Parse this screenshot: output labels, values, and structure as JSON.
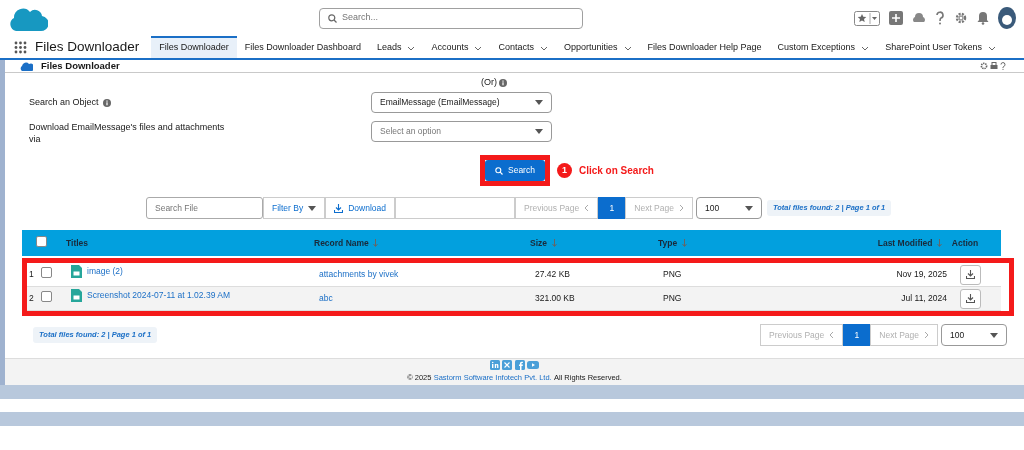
{
  "app_header": {
    "search_placeholder": "Search..."
  },
  "nav": {
    "app_name": "Files Downloader",
    "tabs": [
      {
        "label": "Files Downloader",
        "selected": true,
        "has_menu": false
      },
      {
        "label": "Files Downloader Dashboard",
        "selected": false,
        "has_menu": false
      },
      {
        "label": "Leads",
        "selected": false,
        "has_menu": true
      },
      {
        "label": "Accounts",
        "selected": false,
        "has_menu": true
      },
      {
        "label": "Contacts",
        "selected": false,
        "has_menu": true
      },
      {
        "label": "Opportunities",
        "selected": false,
        "has_menu": true
      },
      {
        "label": "Files Downloader Help Page",
        "selected": false,
        "has_menu": false
      },
      {
        "label": "Custom Exceptions",
        "selected": false,
        "has_menu": true
      },
      {
        "label": "SharePoint User Tokens",
        "selected": false,
        "has_menu": true
      }
    ]
  },
  "page_header": {
    "title": "Files Downloader"
  },
  "form": {
    "or_label": "(Or)",
    "fields": [
      {
        "label": "Search an Object",
        "info": true,
        "value": "EmailMessage (EmailMessage)"
      },
      {
        "label": "Download EmailMessage's files and attachments via",
        "info": false,
        "placeholder": "Select an option"
      }
    ],
    "search_button": "Search"
  },
  "annotation": {
    "number": "1",
    "text": "Click on Search"
  },
  "toolbar": {
    "search_placeholder": "Search File",
    "filter_button": "Filter By",
    "download_button": "Download",
    "previous_page": "Previous Page",
    "page": "1",
    "next_page": "Next Page",
    "page_size": "100",
    "summary": "Total files found: 2 | Page 1 of 1"
  },
  "table": {
    "select_all_checked": false,
    "columns": [
      {
        "label": "Titles",
        "sortable": false
      },
      {
        "label": "Record Name",
        "sortable": true
      },
      {
        "label": "Size",
        "sortable": true
      },
      {
        "label": "Type",
        "sortable": true
      },
      {
        "label": "Last Modified",
        "sortable": true
      },
      {
        "label": "Action",
        "sortable": false
      }
    ],
    "rows": [
      {
        "index": "1",
        "checked": false,
        "title": "image (2)",
        "record_name": "attachments by vivek",
        "size": "27.42 KB",
        "type": "PNG",
        "last_modified": "Nov 19, 2025"
      },
      {
        "index": "2",
        "checked": false,
        "title": "Screenshot 2024-07-11 at 1.02.39 AM",
        "record_name": "abc",
        "size": "321.00 KB",
        "type": "PNG",
        "last_modified": "Jul 11, 2024"
      }
    ]
  },
  "bottom_pager": {
    "summary": "Total files found: 2 | Page 1 of 1",
    "previous_page": "Previous Page",
    "page": "1",
    "next_page": "Next Page",
    "page_size": "100"
  },
  "footer": {
    "copyright": "© 2025",
    "company": "Sastorm Software Infotech Pvt. Ltd.",
    "rights": "All Rights Reserved."
  }
}
